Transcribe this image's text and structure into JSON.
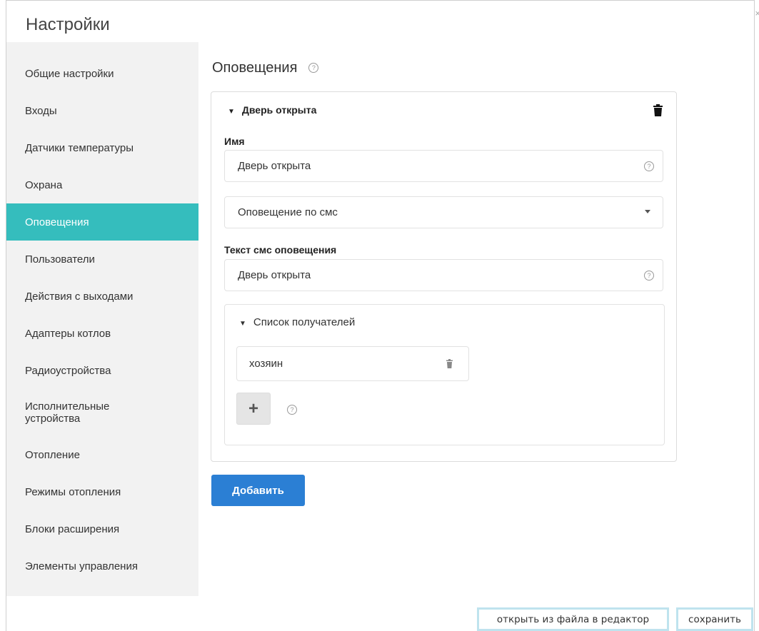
{
  "dialog": {
    "title": "Настройки",
    "close_symbol": "×"
  },
  "sidebar": {
    "items": [
      {
        "label": "Общие настройки"
      },
      {
        "label": "Входы"
      },
      {
        "label": "Датчики температуры"
      },
      {
        "label": "Охрана"
      },
      {
        "label": "Оповещения",
        "active": true
      },
      {
        "label": "Пользователи"
      },
      {
        "label": "Действия с выходами"
      },
      {
        "label": "Адаптеры котлов"
      },
      {
        "label": "Радиоустройства"
      },
      {
        "label": "Исполнительные устройства"
      },
      {
        "label": "Отопление"
      },
      {
        "label": "Режимы отопления"
      },
      {
        "label": "Блоки расширения"
      },
      {
        "label": "Элементы управления"
      }
    ],
    "active_color": "#35bdbd"
  },
  "main": {
    "title": "Оповещения",
    "help_symbol": "?",
    "card": {
      "header": "Дверь открыта",
      "caret": "▼",
      "name_label": "Имя",
      "name_value": "Дверь открыта",
      "type_value": "Оповещение по смс",
      "sms_label": "Текст смс оповещения",
      "sms_value": "Дверь открыта",
      "recipients": {
        "header": "Список получателей",
        "items": [
          {
            "name": "хозяин"
          }
        ],
        "add_symbol": "+"
      }
    },
    "add_button": "Добавить",
    "add_button_color": "#2b7fd4"
  },
  "footer": {
    "open_button": "открыть из файла в редактор",
    "save_button": "сохранить"
  }
}
